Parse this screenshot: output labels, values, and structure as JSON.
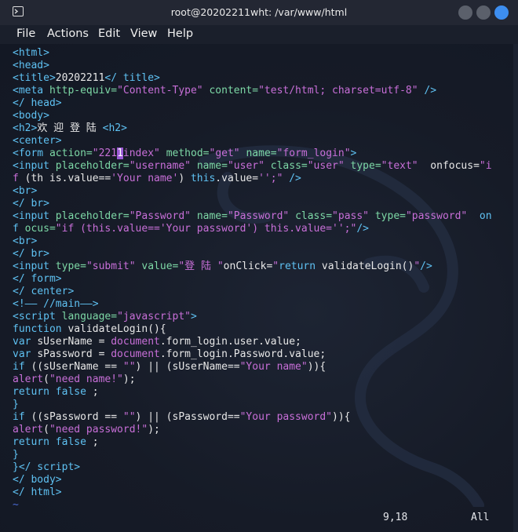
{
  "window": {
    "title": "root@20202211wht: /var/www/html"
  },
  "menubar": {
    "items": [
      "File",
      "Actions",
      "Edit",
      "View",
      "Help"
    ]
  },
  "editor": {
    "lines": [
      [
        {
          "c": "tag",
          "t": "<html>"
        }
      ],
      [
        {
          "c": "tag",
          "t": "<head>"
        }
      ],
      [
        {
          "c": "tag",
          "t": "<title>"
        },
        {
          "c": "txt",
          "t": "20202211"
        },
        {
          "c": "tag",
          "t": "</ title>"
        }
      ],
      [
        {
          "c": "tag",
          "t": "<meta "
        },
        {
          "c": "attr",
          "t": "http-equiv="
        },
        {
          "c": "str",
          "t": "\"Content-Type\""
        },
        {
          "c": "attr",
          "t": " content="
        },
        {
          "c": "str",
          "t": "\"test/html; charset=utf-8\""
        },
        {
          "c": "tag",
          "t": " />"
        }
      ],
      [
        {
          "c": "tag",
          "t": "</ head>"
        }
      ],
      [
        {
          "c": "tag",
          "t": "<body>"
        }
      ],
      [
        {
          "c": "tag",
          "t": "<h2>"
        },
        {
          "c": "txt",
          "t": "欢 迎 登 陆 "
        },
        {
          "c": "tag",
          "t": "<h2>"
        }
      ],
      [
        {
          "c": "tag",
          "t": "<center>"
        }
      ],
      [
        {
          "c": "tag",
          "t": "<form "
        },
        {
          "c": "attr",
          "t": "action="
        },
        {
          "c": "str",
          "t": "\"221"
        },
        {
          "c": "cursor",
          "t": "1"
        },
        {
          "c": "str",
          "t": "index\""
        },
        {
          "c": "attr",
          "t": " method="
        },
        {
          "c": "str",
          "t": "\"get\""
        },
        {
          "c": "attr",
          "t": " name="
        },
        {
          "c": "str",
          "t": "\"form_login\""
        },
        {
          "c": "tag",
          "t": ">"
        }
      ],
      [
        {
          "c": "tag",
          "t": "<input "
        },
        {
          "c": "attr",
          "t": "placeholder="
        },
        {
          "c": "str",
          "t": "\"username\""
        },
        {
          "c": "attr",
          "t": " name="
        },
        {
          "c": "str",
          "t": "\"user\""
        },
        {
          "c": "attr",
          "t": " class="
        },
        {
          "c": "str",
          "t": "\"user\""
        },
        {
          "c": "attr",
          "t": " type="
        },
        {
          "c": "str",
          "t": "\"text\""
        },
        {
          "c": "txt",
          "t": "  onfocus="
        },
        {
          "c": "str",
          "t": "\"i"
        }
      ],
      [
        {
          "c": "str",
          "t": "f "
        },
        {
          "c": "txt",
          "t": "(th is.value=="
        },
        {
          "c": "str",
          "t": "'Your name'"
        },
        {
          "c": "txt",
          "t": ") "
        },
        {
          "c": "kw",
          "t": "this"
        },
        {
          "c": "txt",
          "t": ".value="
        },
        {
          "c": "str",
          "t": "'';\""
        },
        {
          "c": "tag",
          "t": " />"
        }
      ],
      [
        {
          "c": "tag",
          "t": "<br>"
        }
      ],
      [
        {
          "c": "tag",
          "t": "</ br>"
        }
      ],
      [
        {
          "c": "tag",
          "t": "<input "
        },
        {
          "c": "attr",
          "t": "placeholder="
        },
        {
          "c": "str",
          "t": "\"Password\""
        },
        {
          "c": "attr",
          "t": " name="
        },
        {
          "c": "str",
          "t": "\"Password\""
        },
        {
          "c": "attr",
          "t": " class="
        },
        {
          "c": "str",
          "t": "\"pass\""
        },
        {
          "c": "attr",
          "t": " type="
        },
        {
          "c": "str",
          "t": "\"password\""
        },
        {
          "c": "kw",
          "t": "  on"
        }
      ],
      [
        {
          "c": "kw",
          "t": "f "
        },
        {
          "c": "attr",
          "t": "ocus="
        },
        {
          "c": "str",
          "t": "\"if (this.value=='Your password') this.value='';\""
        },
        {
          "c": "tag",
          "t": "/>"
        }
      ],
      [
        {
          "c": "tag",
          "t": "<br>"
        }
      ],
      [
        {
          "c": "tag",
          "t": "</ br>"
        }
      ],
      [
        {
          "c": "tag",
          "t": "<input "
        },
        {
          "c": "attr",
          "t": "type="
        },
        {
          "c": "str",
          "t": "\"submit\""
        },
        {
          "c": "attr",
          "t": " value="
        },
        {
          "c": "str",
          "t": "\"登 陆 \""
        },
        {
          "c": "txt",
          "t": "onClick="
        },
        {
          "c": "str",
          "t": "\""
        },
        {
          "c": "kw",
          "t": "return "
        },
        {
          "c": "txt",
          "t": "validateLogin()"
        },
        {
          "c": "str",
          "t": "\""
        },
        {
          "c": "tag",
          "t": "/>"
        }
      ],
      [
        {
          "c": "tag",
          "t": "</ form>"
        }
      ],
      [
        {
          "c": "tag",
          "t": "</ center>"
        }
      ],
      [
        {
          "c": "tag",
          "t": "<!—— //main——>"
        }
      ],
      [
        {
          "c": "tag",
          "t": "<script "
        },
        {
          "c": "attr",
          "t": "language="
        },
        {
          "c": "str",
          "t": "\"javascript\""
        },
        {
          "c": "tag",
          "t": ">"
        }
      ],
      [
        {
          "c": "kw",
          "t": "function "
        },
        {
          "c": "txt",
          "t": "validateLogin(){"
        }
      ],
      [
        {
          "c": "kw",
          "t": "var "
        },
        {
          "c": "txt",
          "t": "sUserName = "
        },
        {
          "c": "str",
          "t": "document"
        },
        {
          "c": "txt",
          "t": ".form_login.user.value;"
        }
      ],
      [
        {
          "c": "kw",
          "t": "var "
        },
        {
          "c": "txt",
          "t": "sPassword = "
        },
        {
          "c": "str",
          "t": "document"
        },
        {
          "c": "txt",
          "t": ".form_login.Password.value;"
        }
      ],
      [
        {
          "c": "kw",
          "t": "if "
        },
        {
          "c": "txt",
          "t": "((sUserName == "
        },
        {
          "c": "str",
          "t": "\"\""
        },
        {
          "c": "txt",
          "t": ") || (sUserName=="
        },
        {
          "c": "str",
          "t": "\"Your name\""
        },
        {
          "c": "txt",
          "t": ")){"
        }
      ],
      [
        {
          "c": "str",
          "t": "alert"
        },
        {
          "c": "txt",
          "t": "("
        },
        {
          "c": "str",
          "t": "\"need name!\""
        },
        {
          "c": "txt",
          "t": ");"
        }
      ],
      [
        {
          "c": "kw",
          "t": "return false "
        },
        {
          "c": "txt",
          "t": ";"
        }
      ],
      [
        {
          "c": "kw",
          "t": "}"
        }
      ],
      [
        {
          "c": "kw",
          "t": "if "
        },
        {
          "c": "txt",
          "t": "((sPassword == "
        },
        {
          "c": "str",
          "t": "\"\""
        },
        {
          "c": "txt",
          "t": ") || (sPassword=="
        },
        {
          "c": "str",
          "t": "\"Your password\""
        },
        {
          "c": "txt",
          "t": ")){"
        }
      ],
      [
        {
          "c": "str",
          "t": "alert"
        },
        {
          "c": "txt",
          "t": "("
        },
        {
          "c": "str",
          "t": "\"need password!\""
        },
        {
          "c": "txt",
          "t": ");"
        }
      ],
      [
        {
          "c": "kw",
          "t": "return false "
        },
        {
          "c": "txt",
          "t": ";"
        }
      ],
      [
        {
          "c": "kw",
          "t": "}"
        }
      ],
      [
        {
          "c": "kw",
          "t": "}"
        },
        {
          "c": "tag",
          "t": "</ script>"
        }
      ],
      [
        {
          "c": "tag",
          "t": "</ body>"
        }
      ],
      [
        {
          "c": "tag",
          "t": "</ html>"
        }
      ],
      [
        {
          "c": "tilde",
          "t": "~"
        }
      ]
    ]
  },
  "status": {
    "position": "9,18",
    "scroll": "All"
  },
  "colors": {
    "tag": "#5fc2f3",
    "attr": "#7dd8a6",
    "string": "#c86fd8",
    "text": "#e8e8e8",
    "cursor": "#9b59d6",
    "close_button": "#3d8ef0"
  }
}
